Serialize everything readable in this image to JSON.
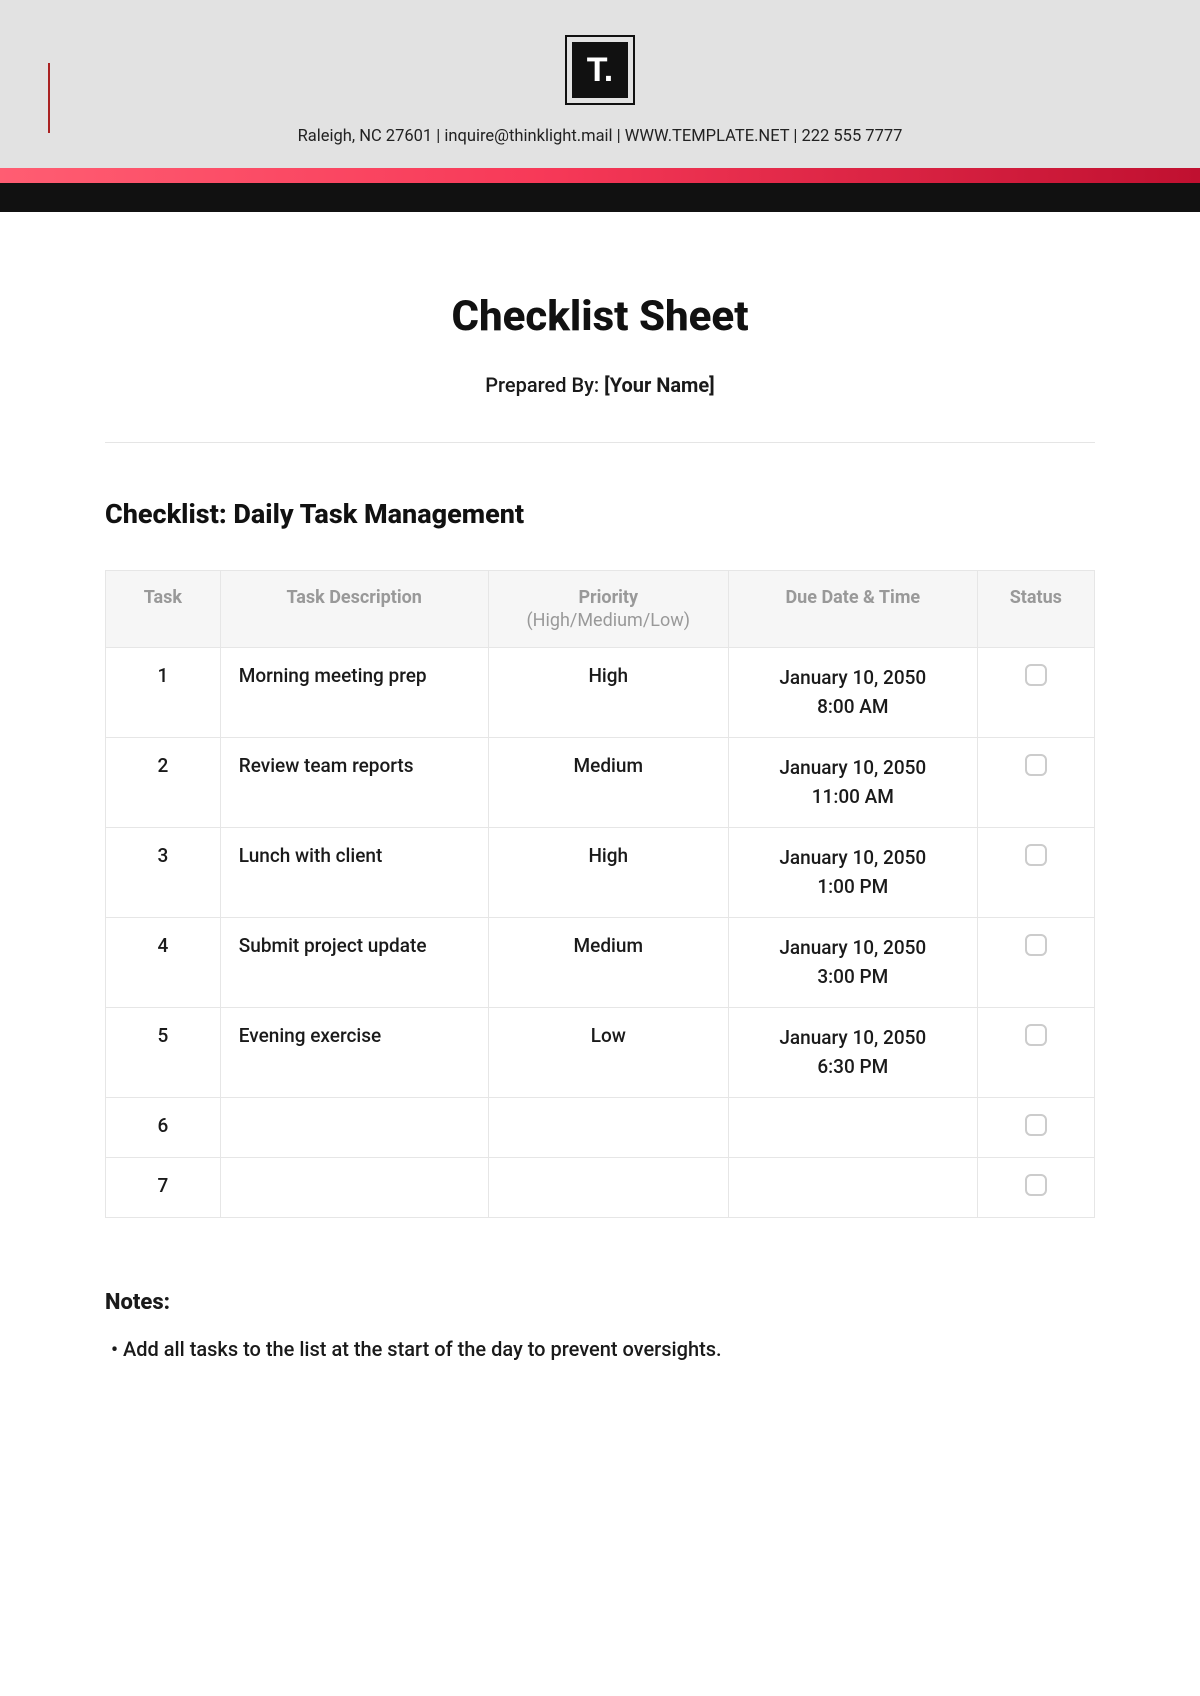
{
  "logo_text": "T.",
  "contact_line": "Raleigh, NC 27601 | inquire@thinklight.mail | WWW.TEMPLATE.NET | 222 555 7777",
  "page_title": "Checklist Sheet",
  "prepared_label": "Prepared By: ",
  "prepared_value": "[Your Name]",
  "subtitle": "Checklist: Daily Task Management",
  "columns": {
    "task": "Task",
    "desc": "Task Description",
    "priority": "Priority",
    "priority_sub": "(High/Medium/Low)",
    "due": "Due Date & Time",
    "status": "Status"
  },
  "rows": [
    {
      "num": "1",
      "desc": "Morning meeting prep",
      "priority": "High",
      "due_date": "January 10, 2050",
      "due_time": "8:00 AM"
    },
    {
      "num": "2",
      "desc": "Review team reports",
      "priority": "Medium",
      "due_date": "January 10, 2050",
      "due_time": "11:00 AM"
    },
    {
      "num": "3",
      "desc": "Lunch with client",
      "priority": "High",
      "due_date": "January 10, 2050",
      "due_time": "1:00 PM"
    },
    {
      "num": "4",
      "desc": "Submit project update",
      "priority": "Medium",
      "due_date": "January 10, 2050",
      "due_time": "3:00 PM"
    },
    {
      "num": "5",
      "desc": "Evening exercise",
      "priority": "Low",
      "due_date": "January 10, 2050",
      "due_time": "6:30 PM"
    },
    {
      "num": "6",
      "desc": "",
      "priority": "",
      "due_date": "",
      "due_time": ""
    },
    {
      "num": "7",
      "desc": "",
      "priority": "",
      "due_date": "",
      "due_time": ""
    }
  ],
  "notes_heading": "Notes:",
  "notes": [
    "Add all tasks to the list at the start of the day to prevent oversights."
  ]
}
